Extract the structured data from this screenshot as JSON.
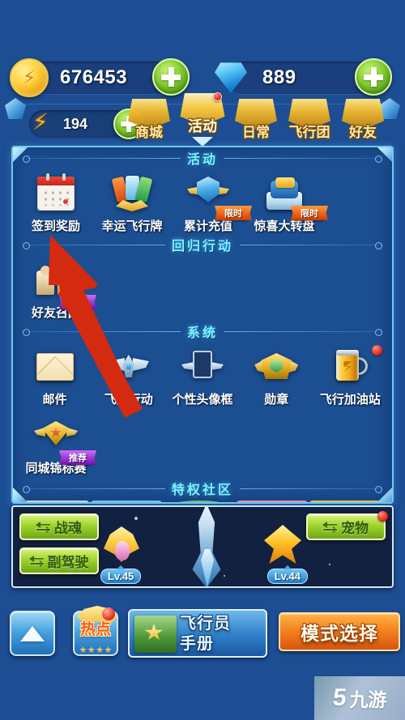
{
  "currency": {
    "coin": {
      "icon": "gold-coin-icon",
      "value": "676453",
      "add_label": "+"
    },
    "gem": {
      "icon": "diamond-icon",
      "value": "889",
      "add_label": "+"
    },
    "energy": {
      "icon": "lightning-bolt-icon",
      "value": "194",
      "add_label": "+"
    }
  },
  "nav": {
    "tabs": [
      {
        "label": "商城",
        "active": false,
        "dot": false
      },
      {
        "label": "活动",
        "active": true,
        "dot": true
      },
      {
        "label": "日常",
        "active": false,
        "dot": false
      },
      {
        "label": "飞行团",
        "active": false,
        "dot": false
      },
      {
        "label": "好友",
        "active": false,
        "dot": false
      }
    ]
  },
  "panel": {
    "sections": [
      {
        "title": "活动",
        "items": [
          {
            "label": "签到奖励",
            "icon": "calendar-icon",
            "badge": "",
            "dot": false
          },
          {
            "label": "幸运飞行牌",
            "icon": "lucky-card-icon",
            "badge": "",
            "dot": false
          },
          {
            "label": "累计充值",
            "icon": "recharge-shield-icon",
            "badge": "限时",
            "dot": false
          },
          {
            "label": "惊喜大转盘",
            "icon": "wheel-icon",
            "badge": "限时",
            "dot": false
          }
        ]
      },
      {
        "title": "回归行动",
        "items": [
          {
            "label": "好友召回",
            "icon": "friend-recall-icon",
            "badge": "推荐",
            "dot": false
          }
        ]
      },
      {
        "title": "系统",
        "items": [
          {
            "label": "邮件",
            "icon": "mail-icon",
            "badge": "",
            "dot": false
          },
          {
            "label": "飞鹰行动",
            "icon": "eagle-wings-icon",
            "badge": "",
            "dot": false
          },
          {
            "label": "个性头像框",
            "icon": "avatar-frame-icon",
            "badge": "",
            "dot": false
          },
          {
            "label": "勋章",
            "icon": "medal-icon",
            "badge": "",
            "dot": false
          },
          {
            "label": "飞行加油站",
            "icon": "fuel-can-icon",
            "badge": "",
            "dot": true
          }
        ]
      },
      {
        "title": "",
        "items": [
          {
            "label": "同城锦标赛",
            "icon": "trophy-icon",
            "badge": "推荐",
            "dot": false
          }
        ]
      },
      {
        "title": "特权社区",
        "items": []
      }
    ]
  },
  "stage": {
    "buttons": [
      {
        "label": "战魂",
        "icon": "swap-arrows-icon",
        "dot": false
      },
      {
        "label": "副驾驶",
        "icon": "swap-arrows-icon",
        "dot": false
      },
      {
        "label": "宠物",
        "icon": "swap-arrows-icon",
        "dot": true
      }
    ],
    "pets": [
      {
        "level": "Lv.45"
      },
      {
        "level": "Lv.44"
      }
    ]
  },
  "bottom": {
    "up_button": {
      "icon": "up-triangle-icon"
    },
    "hotspot": {
      "label": "热点",
      "icon": "hot-star-icon"
    },
    "handbook": {
      "line1": "飞行员",
      "line2": "手册",
      "icon": "book-icon"
    },
    "mode_select": {
      "label": "模式选择"
    }
  },
  "watermark": {
    "logo": "5",
    "text": "九游"
  },
  "colors": {
    "bg": "#1d4d92",
    "panel_border": "#6fc8f2",
    "section_title": "#7ff0ff",
    "accent_green": "#9ed42e",
    "accent_orange": "#f4811f",
    "badge_limited": "#f25c10",
    "badge_rec": "#9b2fd8",
    "red_dot": "#e21c0e",
    "annotation_arrow": "#d42a10"
  }
}
